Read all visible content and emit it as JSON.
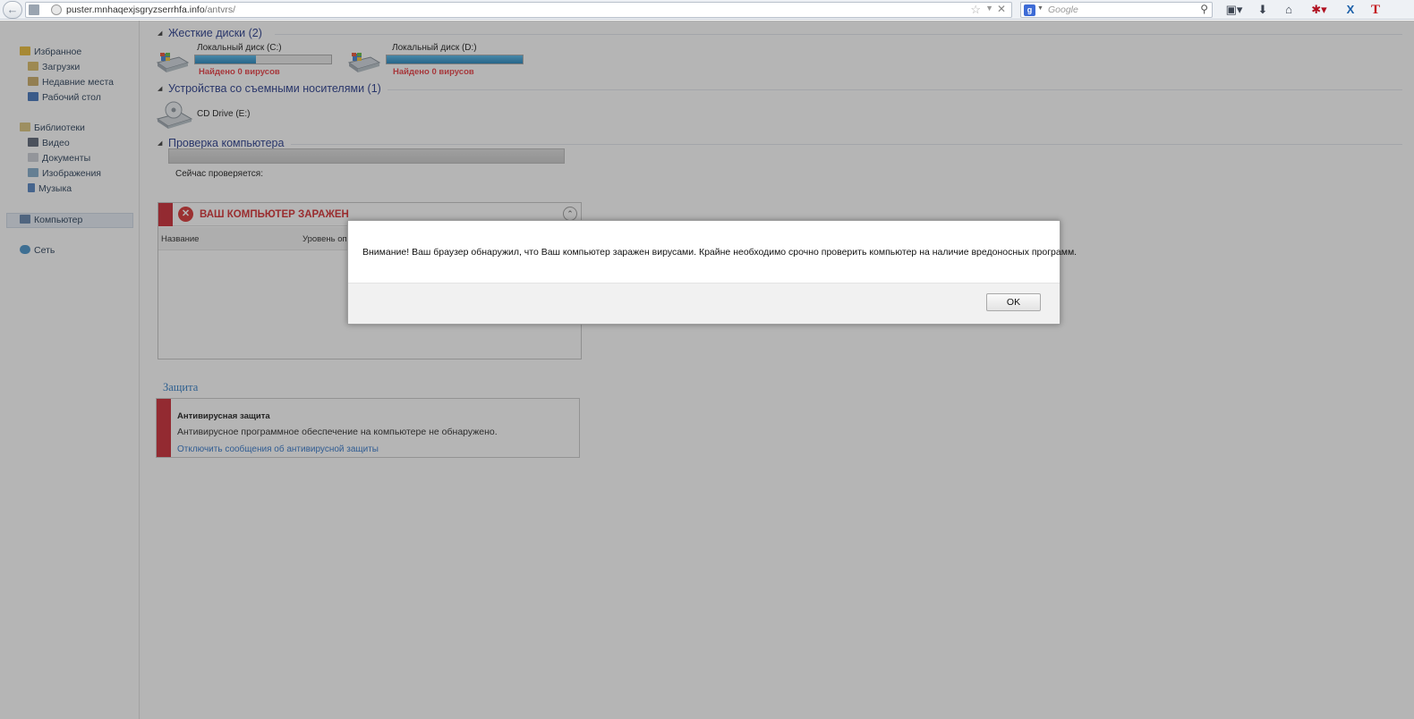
{
  "browser": {
    "url_domain": "puster.mnhaqexjsgryzserrhfa.info",
    "url_path": "/antvrs/",
    "search_engine_letter": "g",
    "search_placeholder": "Google",
    "icons": [
      "back-icon",
      "page-icon",
      "globe-icon",
      "star-icon",
      "dropdown-icon",
      "close-icon",
      "google-icon",
      "search-icon",
      "bookmarks-icon",
      "download-icon",
      "home-icon",
      "addon-icon",
      "x-icon",
      "t-icon"
    ],
    "x_label": "X",
    "t_label": "T"
  },
  "sidebar": {
    "favorites": "Избранное",
    "downloads": "Загрузки",
    "recent": "Недавние места",
    "desktop": "Рабочий стол",
    "libraries": "Библиотеки",
    "video": "Видео",
    "documents": "Документы",
    "images": "Изображения",
    "music": "Музыка",
    "computer": "Компьютер",
    "network": "Сеть"
  },
  "hard_disks": {
    "header": "Жесткие диски (2)",
    "drives": [
      {
        "name": "Локальный диск (C:)",
        "status": "Найдено 0 вирусов",
        "fill_percent": 45
      },
      {
        "name": "Локальный диск (D:)",
        "status": "Найдено 0 вирусов",
        "fill_percent": 100
      }
    ]
  },
  "removable": {
    "header": "Устройства со съемными носителями (1)",
    "cd_name": "CD Drive (E:)"
  },
  "scan": {
    "header": "Проверка компьютера",
    "current_label": "Сейчас проверяется:"
  },
  "infected": {
    "title": "ВАШ КОМПЬЮТЕР ЗАРАЖЕН",
    "col_name": "Название",
    "col_level": "Уровень опа"
  },
  "protection": {
    "header": "Защита",
    "title": "Антивирусная защита",
    "text": "Антивирусное программное обеспечение на компьютере не обнаружено.",
    "link": "Отключить сообщения об антивирусной защиты"
  },
  "dialog": {
    "message": "Внимание! Ваш браузер обнаружил, что Ваш компьютер заражен вирусами. Крайне необходимо срочно проверить компьютер на наличие вредоносных программ.",
    "ok": "OK"
  },
  "colors": {
    "accent_red": "#c9202a",
    "link_blue": "#2a71c8",
    "group_header": "#1e3287",
    "progress_fill": "#1b7fb8"
  }
}
